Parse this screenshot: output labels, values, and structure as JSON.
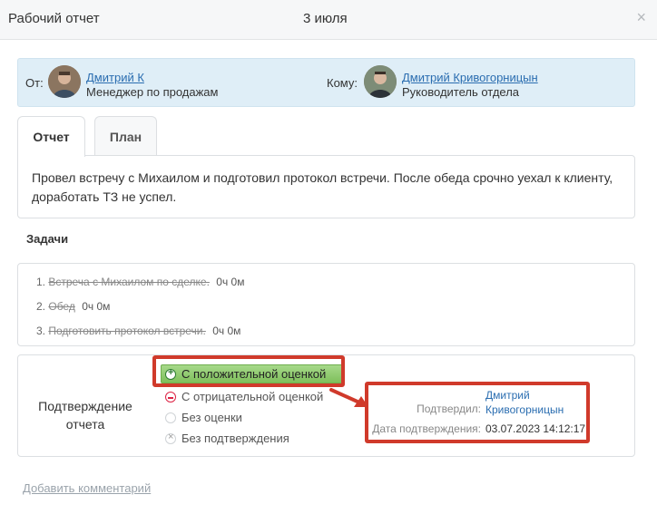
{
  "window": {
    "title": "Рабочий отчет",
    "date": "3 июля",
    "close_symbol": "×"
  },
  "people": {
    "from_label": "От:",
    "from_name": "Дмитрий К",
    "from_role": "Менеджер по продажам",
    "to_label": "Кому:",
    "to_name": "Дмитрий Кривогорницын",
    "to_role": "Руководитель отдела"
  },
  "tabs": [
    {
      "label": "Отчет",
      "active": true
    },
    {
      "label": "План",
      "active": false
    }
  ],
  "report": {
    "text": "Провел встречу с Михаилом и подготовил протокол встречи. После обеда срочно уехал к клиенту, доработать ТЗ не успел."
  },
  "tasks": {
    "title": "Задачи",
    "items": [
      {
        "num": "1.",
        "text": "Встреча с Михаилом по сделке.",
        "duration": "0ч 0м"
      },
      {
        "num": "2.",
        "text": "Обед",
        "duration": "0ч 0м"
      },
      {
        "num": "3.",
        "text": "Подготовить протокол встречи.",
        "duration": "0ч 0м"
      }
    ]
  },
  "confirmation": {
    "label": "Подтверждение отчета",
    "options": [
      {
        "label": "С положительной оценкой",
        "icon": "plus-circle-icon",
        "selected": true
      },
      {
        "label": "С отрицательной оценкой",
        "icon": "minus-circle-icon",
        "selected": false
      },
      {
        "label": "Без оценки",
        "icon": "empty-radio-icon",
        "selected": false
      },
      {
        "label": "Без подтверждения",
        "icon": "x-circle-icon",
        "selected": false
      }
    ],
    "confirmed_by_label": "Подтвердил:",
    "confirmed_by_name_line1": "Дмитрий",
    "confirmed_by_name_line2": "Кривогорницын",
    "date_label": "Дата подтверждения:",
    "date_value": "03.07.2023 14:12:17"
  },
  "footer": {
    "add_comment": "Добавить комментарий"
  },
  "colors": {
    "accent_link": "#2a6db0",
    "highlight": "#d03a2b",
    "selected_green": "#8dc96b",
    "people_bg": "#dfeef7"
  }
}
